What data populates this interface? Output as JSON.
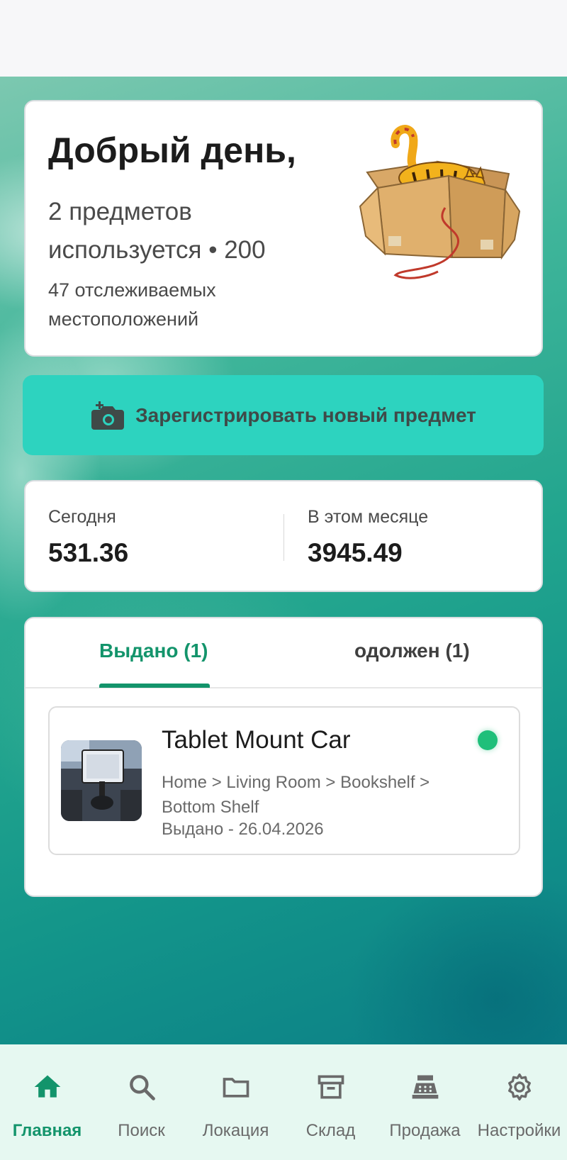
{
  "greeting": {
    "title": "Добрый день,",
    "items_line1": "2 предметов",
    "items_line2": "используется • 200",
    "locations": "47 отслеживаемых местоположений"
  },
  "register_button": {
    "label": "Зарегистрировать новый предмет",
    "icon": "add-camera-icon"
  },
  "stats": {
    "today_label": "Сегодня",
    "today_value": "531.36",
    "month_label": "В этом месяце",
    "month_value": "3945.49"
  },
  "tabs": [
    {
      "label": "Выдано (1)",
      "active": true
    },
    {
      "label": "одолжен (1)",
      "active": false
    }
  ],
  "items": [
    {
      "title": "Tablet Mount Car",
      "path": "Home > Living Room > Bookshelf > Bottom Shelf",
      "status": "Выдано - 26.04.2026",
      "status_color": "#1fbf7a"
    }
  ],
  "bottom_nav": [
    {
      "label": "Главная",
      "icon": "home-icon",
      "active": true
    },
    {
      "label": "Поиск",
      "icon": "search-icon",
      "active": false
    },
    {
      "label": "Локация",
      "icon": "folder-icon",
      "active": false
    },
    {
      "label": "Склад",
      "icon": "archive-box-icon",
      "active": false
    },
    {
      "label": "Продажа",
      "icon": "cash-register-icon",
      "active": false
    },
    {
      "label": "Настройки",
      "icon": "gear-icon",
      "active": false
    }
  ],
  "colors": {
    "accent": "#13946b",
    "register_bg": "#2dd3bf",
    "nav_bg": "#e6f8f1"
  }
}
